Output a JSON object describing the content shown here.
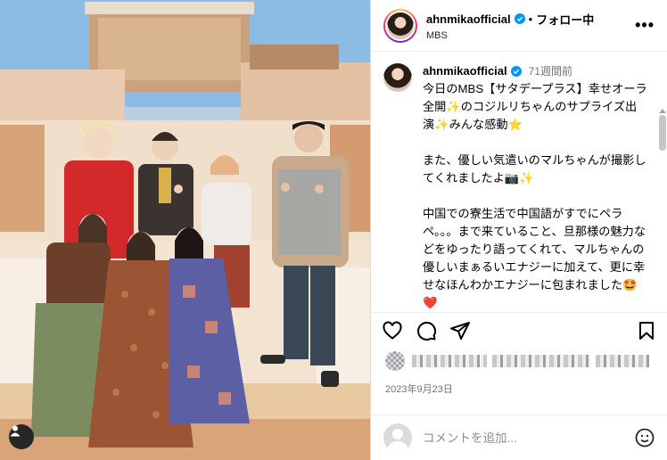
{
  "header": {
    "username": "ahnmikaofficial",
    "dot": "•",
    "follow_label": "フォロー中",
    "subtitle": "MBS",
    "more_label": "•••"
  },
  "caption": {
    "username": "ahnmikaofficial",
    "age": "71週間前",
    "text": "今日のMBS【サタデープラス】幸せオーラ全開✨のコジルリちゃんのサプライズ出演✨みんな感動⭐\n\nまた、優しい気遣いのマルちゃんが撮影してくれましたよ📷✨\n\n中国での寮生活で中国語がすでにペラペ。。。まで来ていること、旦那様の魅力などをゆったり語ってくれて、マルちゃんの優しいまぁるいエナジーに加えて、更に幸せなほんわかエナジーに包まれました🤩❤️"
  },
  "icons": {
    "like": "heart-icon",
    "comment": "comment-icon",
    "share": "share-icon",
    "save": "bookmark-icon",
    "tag": "person-tag-icon",
    "emoji": "emoji-icon",
    "verified": "verified-badge-icon"
  },
  "post": {
    "date": "2023年9月23日"
  },
  "comment": {
    "placeholder": "コメントを追加..."
  },
  "colors": {
    "verified": "#0095f6",
    "muted": "#737373",
    "border": "#dbdbdb"
  }
}
